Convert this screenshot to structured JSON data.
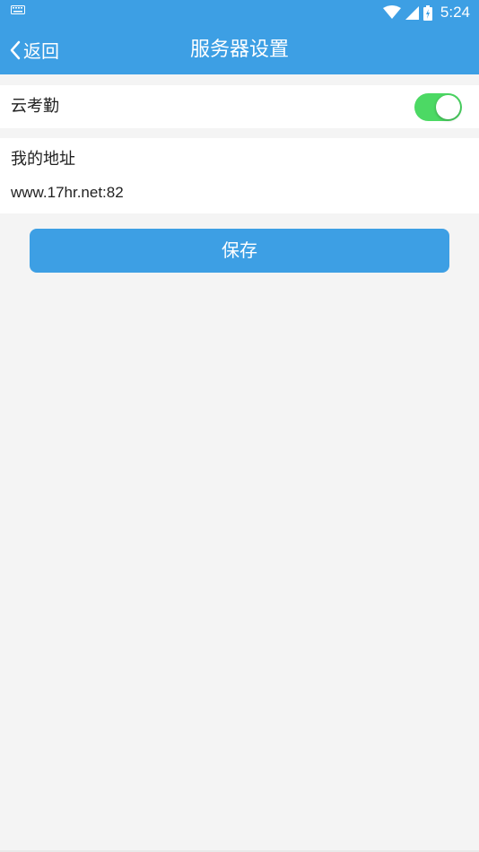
{
  "status_bar": {
    "time": "5:24",
    "icons": [
      "keyboard-icon",
      "wifi-icon",
      "signal-icon",
      "battery-icon"
    ]
  },
  "app_bar": {
    "back_label": "返回",
    "title": "服务器设置"
  },
  "cloud_attendance": {
    "label": "云考勤",
    "enabled": true
  },
  "address": {
    "label": "我的地址",
    "value": "www.17hr.net:82"
  },
  "save_button": {
    "label": "保存"
  },
  "colors": {
    "primary": "#3d9fe4",
    "toggle_on": "#4cd964",
    "background": "#f4f4f4"
  }
}
